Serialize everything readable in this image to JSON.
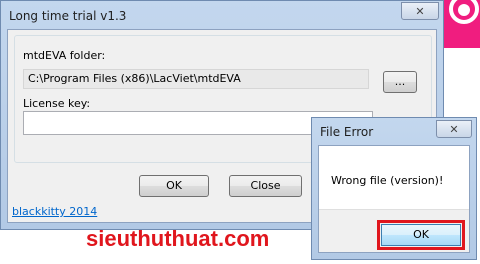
{
  "main_window": {
    "title": "Long time trial v1.3",
    "close_glyph": "✕",
    "folder_label": "mtdEVA folder:",
    "folder_value": "C:\\Program Files (x86)\\LacViet\\mtdEVA",
    "browse_label": "...",
    "license_label": "License key:",
    "license_value": "",
    "ok_label": "OK",
    "close_label": "Close",
    "link_text": "blackkitty 2014"
  },
  "error_dialog": {
    "title": "File Error",
    "close_glyph": "✕",
    "message": "Wrong file (version)!",
    "ok_label": "OK"
  },
  "watermark": "sieuthuthuat.com",
  "colors": {
    "highlight": "#e0161d",
    "brand_pink": "#f01d7f",
    "link": "#0066cc"
  }
}
